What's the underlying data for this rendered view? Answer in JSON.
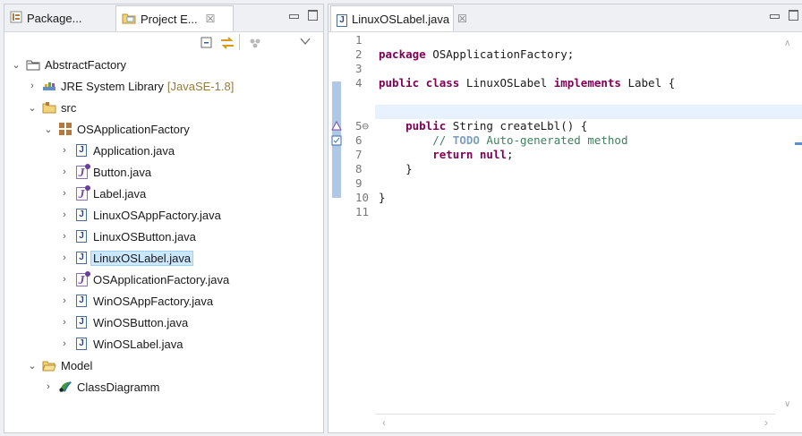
{
  "left_panel": {
    "tabs": [
      {
        "label": "Package..."
      },
      {
        "label": "Project E...",
        "close": "☒"
      }
    ],
    "tree": [
      {
        "label": "AbstractFactory",
        "suffix": ""
      },
      {
        "label": "JRE System Library",
        "suffix": "[JavaSE-1.8]"
      },
      {
        "label": "src",
        "suffix": ""
      },
      {
        "label": "OSApplicationFactory",
        "suffix": ""
      },
      {
        "label": "Application.java",
        "suffix": ""
      },
      {
        "label": "Button.java",
        "suffix": ""
      },
      {
        "label": "Label.java",
        "suffix": ""
      },
      {
        "label": "LinuxOSAppFactory.java",
        "suffix": ""
      },
      {
        "label": "LinuxOSButton.java",
        "suffix": ""
      },
      {
        "label": "LinuxOSLabel.java",
        "suffix": ""
      },
      {
        "label": "OSApplicationFactory.java",
        "suffix": ""
      },
      {
        "label": "WinOSAppFactory.java",
        "suffix": ""
      },
      {
        "label": "WinOSButton.java",
        "suffix": ""
      },
      {
        "label": "WinOSLabel.java",
        "suffix": ""
      },
      {
        "label": "Model",
        "suffix": ""
      },
      {
        "label": "ClassDiagramm",
        "suffix": ""
      }
    ],
    "selected": "LinuxOSLabel.java"
  },
  "editor": {
    "tab": {
      "label": "LinuxOSLabel.java",
      "close": "☒"
    },
    "line_numbers": [
      "1",
      "2",
      "3",
      "4",
      "5⊖",
      "6",
      "7",
      "8",
      "9",
      "10",
      "11"
    ],
    "code": {
      "l1_kw": "package",
      "l1_rest": " OSApplicationFactory;",
      "l3_kw1": "public",
      "l3_kw2": "class",
      "l3_name": " LinuxOSLabel ",
      "l3_kw3": "implements",
      "l3_rest": " Label {",
      "l5_kw": "public",
      "l5_rest": " String createLbl() {",
      "l6_prefix": "// ",
      "l6_todo": "TODO",
      "l6_rest": " Auto-generated method",
      "l7_kw1": "return",
      "l7_kw2": "null",
      "l7_rest": ";",
      "l8": "}",
      "l10": "}"
    }
  },
  "colors": {
    "keyword": "#7f0055",
    "comment": "#3f7f5f",
    "selection": "#cce8ff",
    "current_line": "#e8f2fe"
  },
  "icons": {
    "package_explorer": "package-explorer-icon",
    "project_explorer": "project-explorer-icon",
    "collapse_all": "collapse-all-icon",
    "link_with_editor": "link-with-editor-icon",
    "view_menu": "view-menu-icon",
    "java_file": "java-file-icon",
    "interface_file": "interface-file-icon"
  }
}
